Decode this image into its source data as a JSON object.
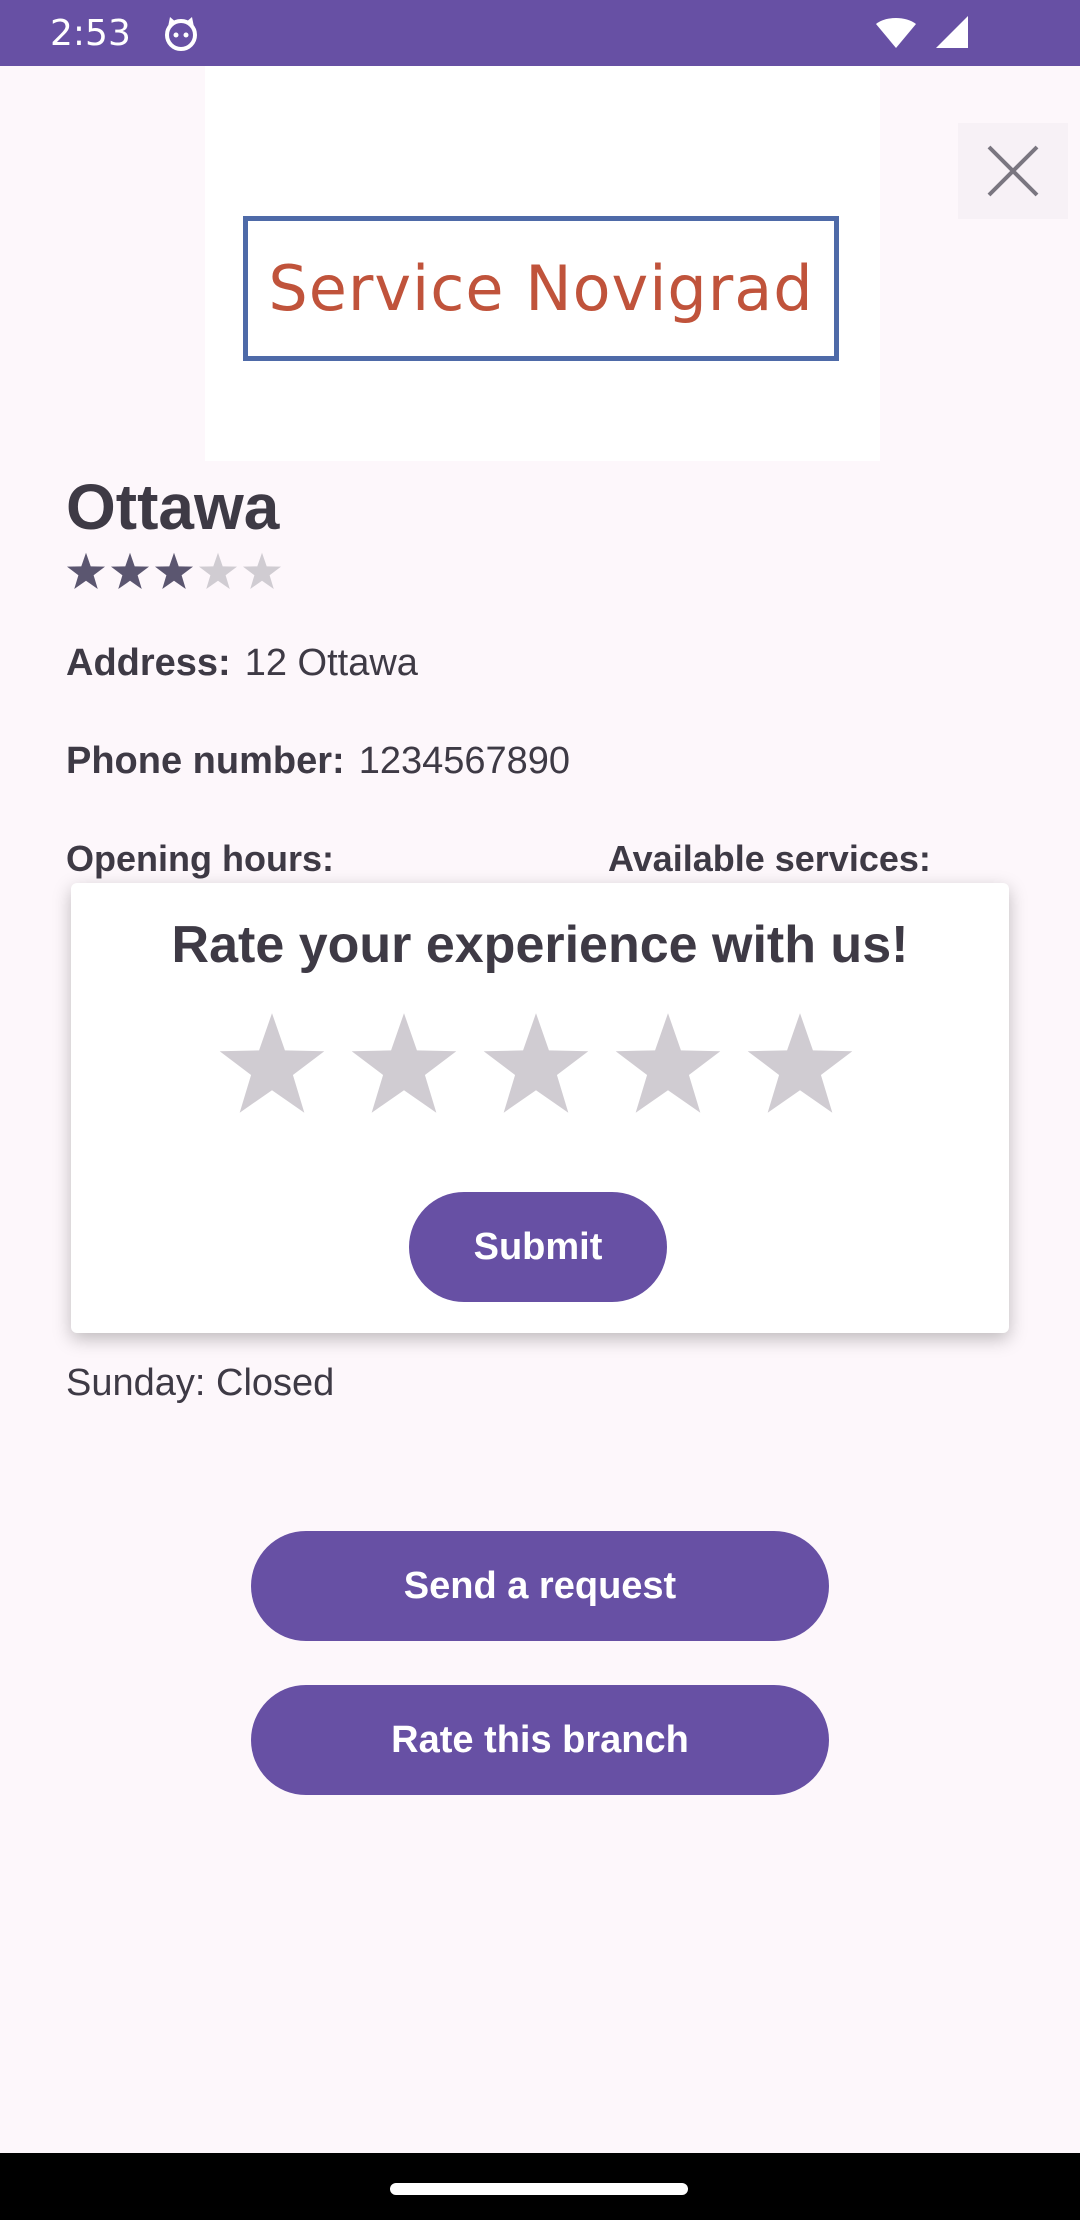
{
  "status_bar": {
    "time": "2:53",
    "icons": [
      "cat-icon",
      "wifi-icon",
      "signal-icon"
    ]
  },
  "logo": {
    "text": "Service Novigrad"
  },
  "branch": {
    "name": "Ottawa",
    "rating": {
      "value": 3,
      "max": 5
    },
    "address_label": "Address:",
    "address_value": "12 Ottawa",
    "phone_label": "Phone number:",
    "phone_value": "1234567890",
    "opening_hours_label": "Opening hours:",
    "available_services_label": "Available services:",
    "sunday_hours": "Sunday: Closed"
  },
  "actions": {
    "send_request": "Send a request",
    "rate_branch": "Rate this branch"
  },
  "rating_dialog": {
    "title": "Rate your experience with us!",
    "stars_selected": 0,
    "stars_max": 5,
    "submit_label": "Submit"
  },
  "colors": {
    "primary": "#6750a4",
    "background": "#fdf7fb",
    "star_filled": "#5b5670",
    "star_empty": "#d0ccd2"
  }
}
